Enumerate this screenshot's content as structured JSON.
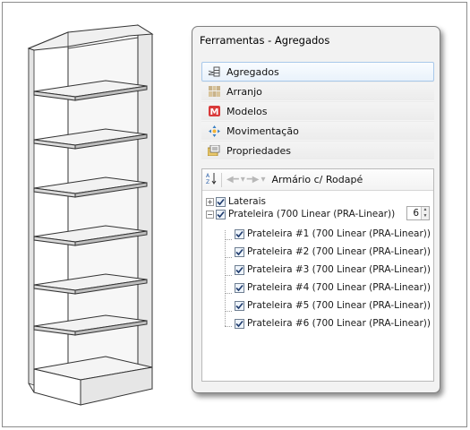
{
  "window": {
    "title": "Ferramentas - Agregados"
  },
  "menu": [
    {
      "label": "Agregados",
      "icon": "aggregates-icon",
      "active": true
    },
    {
      "label": "Arranjo",
      "icon": "arrangement-icon",
      "active": false
    },
    {
      "label": "Modelos",
      "icon": "models-icon",
      "active": false
    },
    {
      "label": "Movimentação",
      "icon": "move-icon",
      "active": false
    },
    {
      "label": "Propriedades",
      "icon": "properties-icon",
      "active": false
    }
  ],
  "tree": {
    "toolbar_title": "Armário c/ Rodapé",
    "nodes": [
      {
        "label": "Laterais",
        "expander": "+",
        "checked": true
      },
      {
        "label": "Prateleira (700 Linear (PRA-Linear))",
        "expander": "−",
        "checked": true,
        "count": "6"
      }
    ],
    "children": [
      {
        "label": "Prateleira #1 (700 Linear (PRA-Linear))",
        "checked": true
      },
      {
        "label": "Prateleira #2 (700 Linear (PRA-Linear))",
        "checked": true
      },
      {
        "label": "Prateleira #3 (700 Linear (PRA-Linear))",
        "checked": true
      },
      {
        "label": "Prateleira #4 (700 Linear (PRA-Linear))",
        "checked": true
      },
      {
        "label": "Prateleira #5 (700 Linear (PRA-Linear))",
        "checked": true
      },
      {
        "label": "Prateleira #6 (700 Linear (PRA-Linear))",
        "checked": true
      }
    ]
  },
  "colors": {
    "active_border": "#a8c8ea",
    "panel_bg": "#f2f2f2"
  }
}
